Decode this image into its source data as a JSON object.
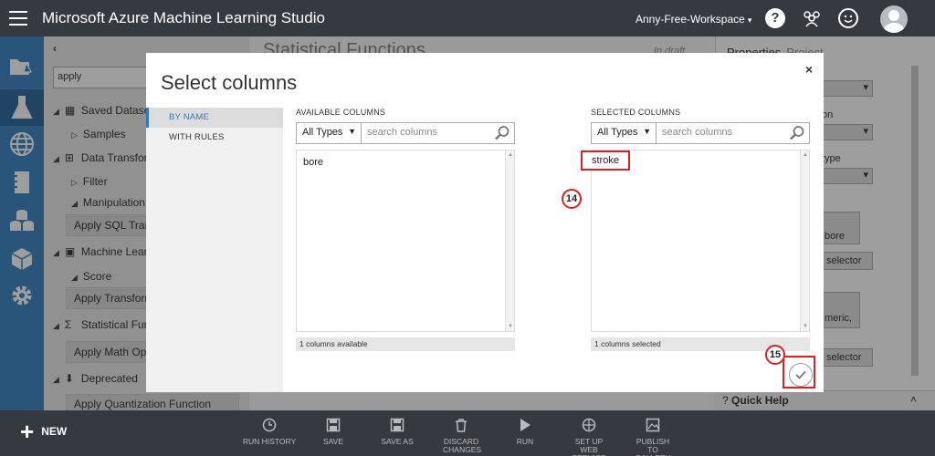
{
  "topbar": {
    "app_title": "Microsoft Azure Machine Learning Studio",
    "workspace": "Anny-Free-Workspace",
    "help_label": "?"
  },
  "palette": {
    "search_value": "apply",
    "items": [
      {
        "label": "Saved Datasets",
        "kind": "group"
      },
      {
        "label": "Samples",
        "kind": "sub"
      },
      {
        "label": "Data Transformation",
        "kind": "group"
      },
      {
        "label": "Filter",
        "kind": "sub"
      },
      {
        "label": "Manipulation",
        "kind": "sub-open"
      },
      {
        "label": "Apply SQL Transformation",
        "kind": "leaf"
      },
      {
        "label": "Machine Learning",
        "kind": "group"
      },
      {
        "label": "Score",
        "kind": "sub-open"
      },
      {
        "label": "Apply Transformation",
        "kind": "leaf"
      },
      {
        "label": "Statistical Functions",
        "kind": "group"
      },
      {
        "label": "Apply Math Operation",
        "kind": "leaf"
      },
      {
        "label": "Deprecated",
        "kind": "group"
      },
      {
        "label": "Apply Quantization Function",
        "kind": "leaf"
      }
    ]
  },
  "canvas": {
    "title": "Statistical Functions",
    "status": "In draft"
  },
  "properties": {
    "tab_properties": "Properties",
    "tab_project": "Project",
    "stub_on": "on",
    "stub_type": "type",
    "stub_bore": "bore",
    "stub_selector1": "selector",
    "stub_numeric": "meric,",
    "stub_selector2": "selector",
    "quick_help": "Quick Help"
  },
  "dialog": {
    "title": "Select columns",
    "close": "×",
    "tabs": [
      "BY NAME",
      "WITH RULES"
    ],
    "available": {
      "label": "AVAILABLE COLUMNS",
      "type_filter": "All Types",
      "search_placeholder": "search columns",
      "items": [
        "bore"
      ],
      "status": "1 columns available"
    },
    "selected": {
      "label": "SELECTED COLUMNS",
      "type_filter": "All Types",
      "search_placeholder": "search columns",
      "items": [
        "stroke"
      ],
      "status": "1 columns selected"
    },
    "move_right": ">",
    "move_left": "<",
    "annotations": {
      "step_a": "14",
      "step_b": "15"
    }
  },
  "bottombar": {
    "new_label": "NEW",
    "commands": [
      {
        "label": "RUN HISTORY",
        "icon": "clock-icon"
      },
      {
        "label": "SAVE",
        "icon": "save-icon"
      },
      {
        "label": "SAVE AS",
        "icon": "save-as-icon"
      },
      {
        "label": "DISCARD CHANGES",
        "icon": "trash-icon"
      },
      {
        "label": "RUN",
        "icon": "play-icon"
      },
      {
        "label": "SET UP WEB SERVICE",
        "icon": "web-service-icon"
      },
      {
        "label": "PUBLISH TO GALLERY",
        "icon": "gallery-icon"
      }
    ]
  },
  "colors": {
    "accent": "#2c7bbf",
    "topbar": "#353a40",
    "annotation": "#e02020"
  }
}
